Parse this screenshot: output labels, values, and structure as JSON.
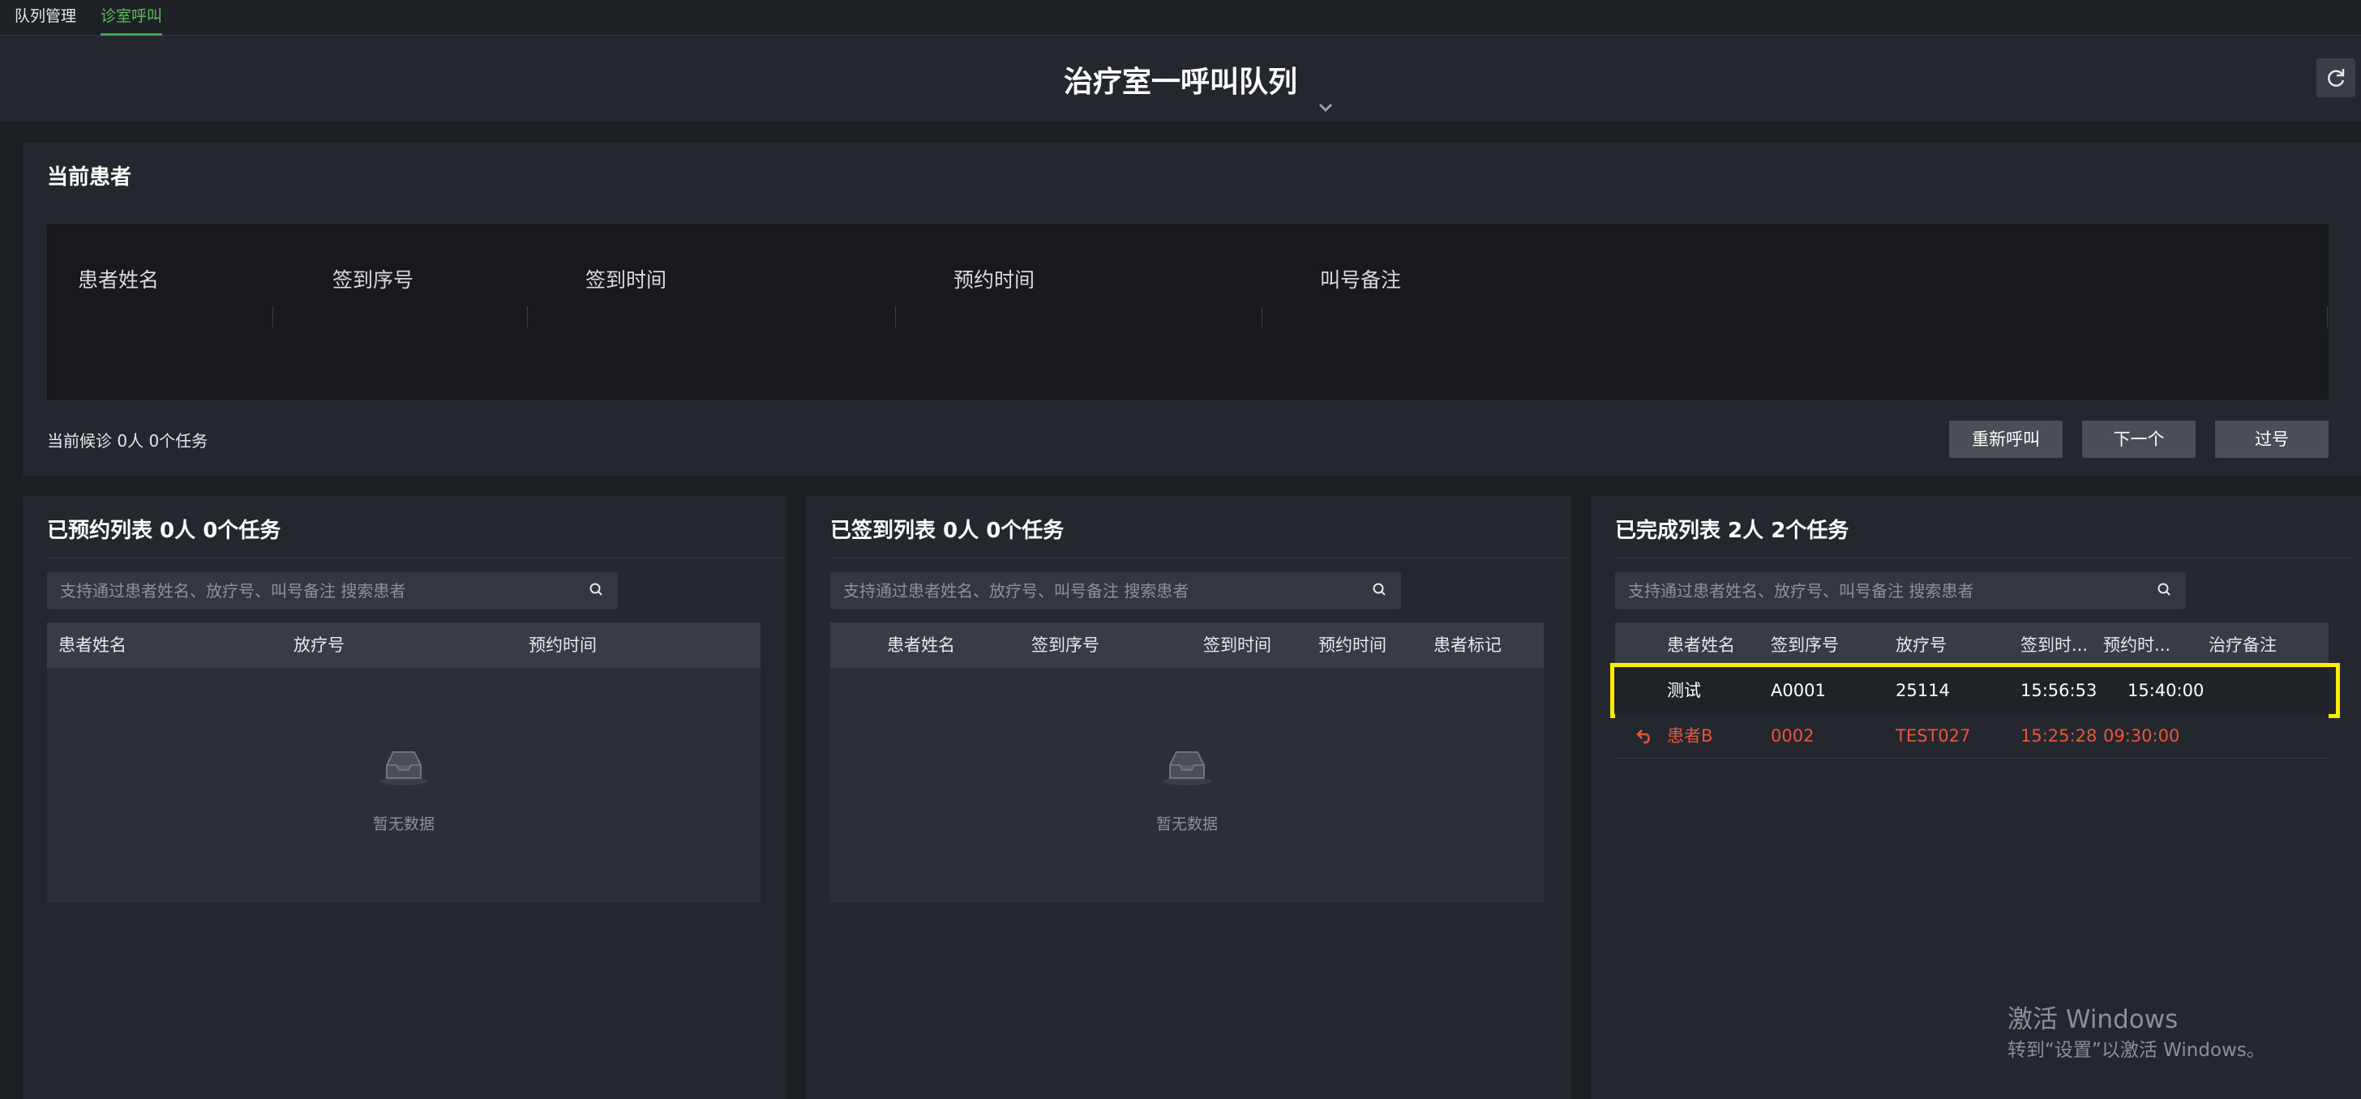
{
  "nav": {
    "tabs": [
      {
        "label": "队列管理"
      },
      {
        "label": "诊室呼叫"
      }
    ],
    "active_index": 1
  },
  "header": {
    "title": "治疗室一呼叫队列",
    "dropdown_icon": "chevron-down-icon",
    "refresh_icon": "refresh-icon"
  },
  "current": {
    "title": "当前患者",
    "columns": [
      "患者姓名",
      "签到序号",
      "签到时间",
      "预约时间",
      "叫号备注"
    ],
    "waiting_text": "当前候诊 0人 0个任务",
    "buttons": {
      "recall": "重新呼叫",
      "next": "下一个",
      "skip": "过号"
    }
  },
  "booked": {
    "title": "已预约列表 0人 0个任务",
    "search_placeholder": "支持通过患者姓名、放疗号、叫号备注 搜索患者",
    "columns": [
      "患者姓名",
      "放疗号",
      "预约时间"
    ],
    "empty_text": "暂无数据"
  },
  "checked_in": {
    "title": "已签到列表 0人 0个任务",
    "search_placeholder": "支持通过患者姓名、放疗号、叫号备注 搜索患者",
    "columns": [
      "患者姓名",
      "签到序号",
      "签到时间",
      "预约时间",
      "患者标记"
    ],
    "empty_text": "暂无数据"
  },
  "completed": {
    "title": "已完成列表 2人 2个任务",
    "search_placeholder": "支持通过患者姓名、放疗号、叫号备注 搜索患者",
    "columns": [
      "患者姓名",
      "签到序号",
      "放疗号",
      "签到时...",
      "预约时...",
      "治疗备注"
    ],
    "rows": [
      {
        "name": "测试",
        "seq": "A0001",
        "rt_no": "25114",
        "checkin": "15:56:53",
        "appt": "15:40:00",
        "note": "",
        "color": "#ffffff",
        "highlighted": true
      },
      {
        "name": "患者B",
        "seq": "0002",
        "rt_no": "TEST027",
        "checkin": "15:25:28",
        "appt": "09:30:00",
        "note": "",
        "color": "#e8553d",
        "highlighted": false
      }
    ]
  },
  "watermark": {
    "line1": "激活 Windows",
    "line2": "转到“设置”以激活 Windows。"
  },
  "colors": {
    "accent_green": "#3aa84a",
    "highlight": "#ffeb00",
    "returned_red": "#e8553d"
  }
}
